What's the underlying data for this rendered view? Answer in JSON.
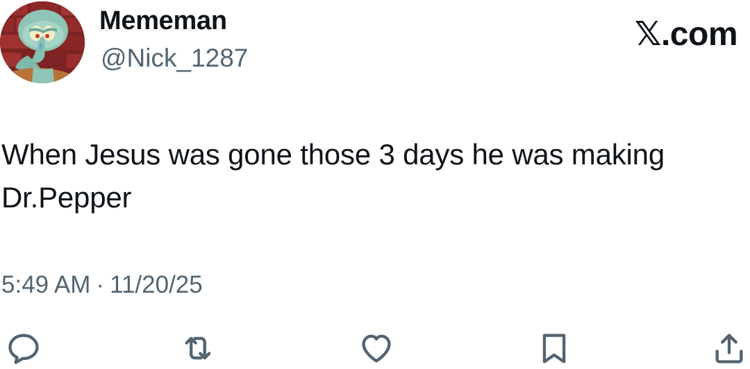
{
  "author": {
    "display_name": "Mememan",
    "handle": "@Nick_1287",
    "avatar_icon": "squidward-avatar"
  },
  "brand": {
    "x_glyph": "𝕏",
    "domain": ".com"
  },
  "tweet": {
    "text": "When Jesus was gone those 3 days he was making\nDr.Pepper",
    "time": "5:49 AM",
    "separator": "·",
    "date": "11/20/25"
  },
  "actions": [
    {
      "name": "reply",
      "icon": "reply-icon"
    },
    {
      "name": "retweet",
      "icon": "retweet-icon"
    },
    {
      "name": "like",
      "icon": "heart-icon"
    },
    {
      "name": "bookmark",
      "icon": "bookmark-icon"
    },
    {
      "name": "share",
      "icon": "share-icon"
    }
  ],
  "colors": {
    "text_primary": "#0f1419",
    "text_secondary": "#536471",
    "background": "#ffffff"
  }
}
